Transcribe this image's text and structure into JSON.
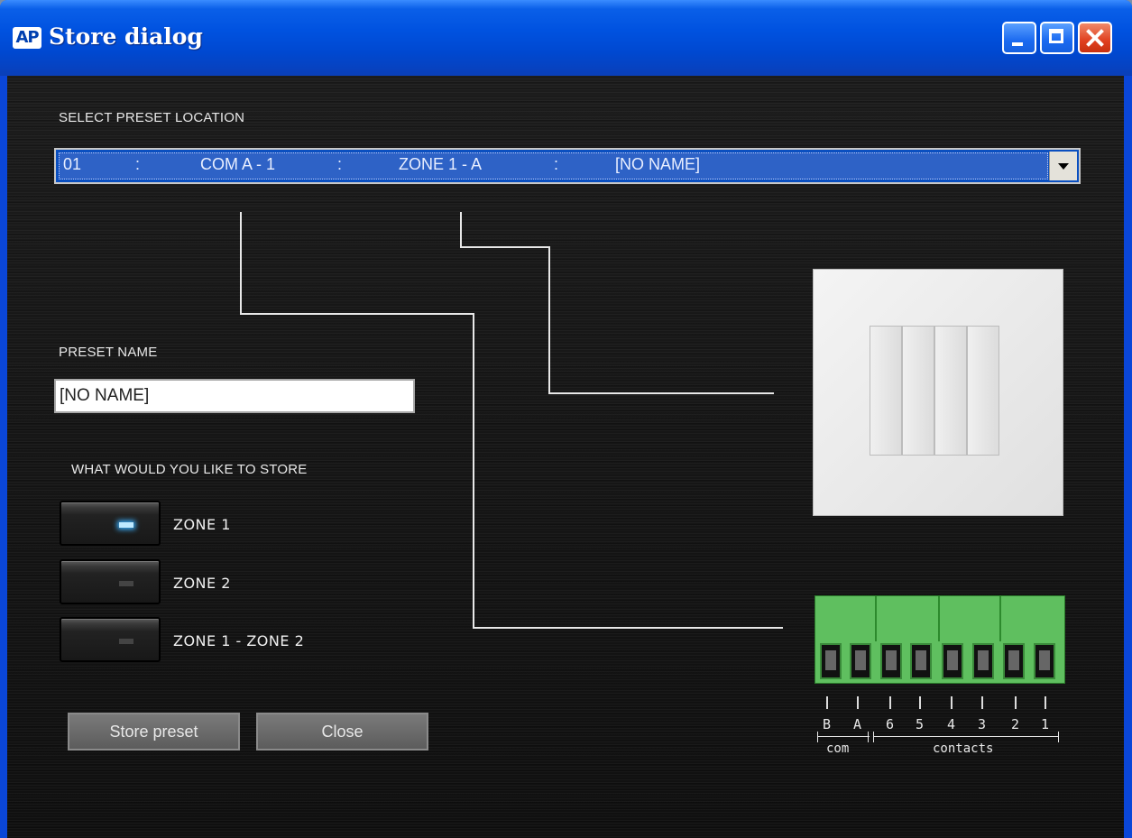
{
  "window": {
    "app_icon": "AP",
    "title": "Store dialog",
    "buttons": [
      "minimize-icon",
      "maximize-icon",
      "close-icon"
    ]
  },
  "preset_location": {
    "label": "SELECT PRESET LOCATION",
    "selected": {
      "number": "01",
      "sep": ":",
      "com": "COM A - 1",
      "zone": "ZONE 1 - A",
      "name": "[NO NAME]"
    }
  },
  "preset_name": {
    "label": "PRESET NAME",
    "value": "[NO NAME]"
  },
  "store": {
    "label": "WHAT WOULD YOU LIKE TO STORE",
    "options": [
      {
        "label": "ZONE 1",
        "active": true
      },
      {
        "label": "ZONE 2",
        "active": false
      },
      {
        "label": "ZONE 1 - ZONE 2",
        "active": false
      }
    ]
  },
  "actions": {
    "store": "Store preset",
    "close": "Close"
  },
  "terminal": {
    "pins": [
      "B",
      "A",
      "6",
      "5",
      "4",
      "3",
      "2",
      "1"
    ],
    "groups": {
      "com": "com",
      "contacts": "contacts"
    }
  },
  "colors": {
    "led_on": "#3ab0ff",
    "selection": "#0a4fc0",
    "terminal": "#5fbf5f"
  }
}
